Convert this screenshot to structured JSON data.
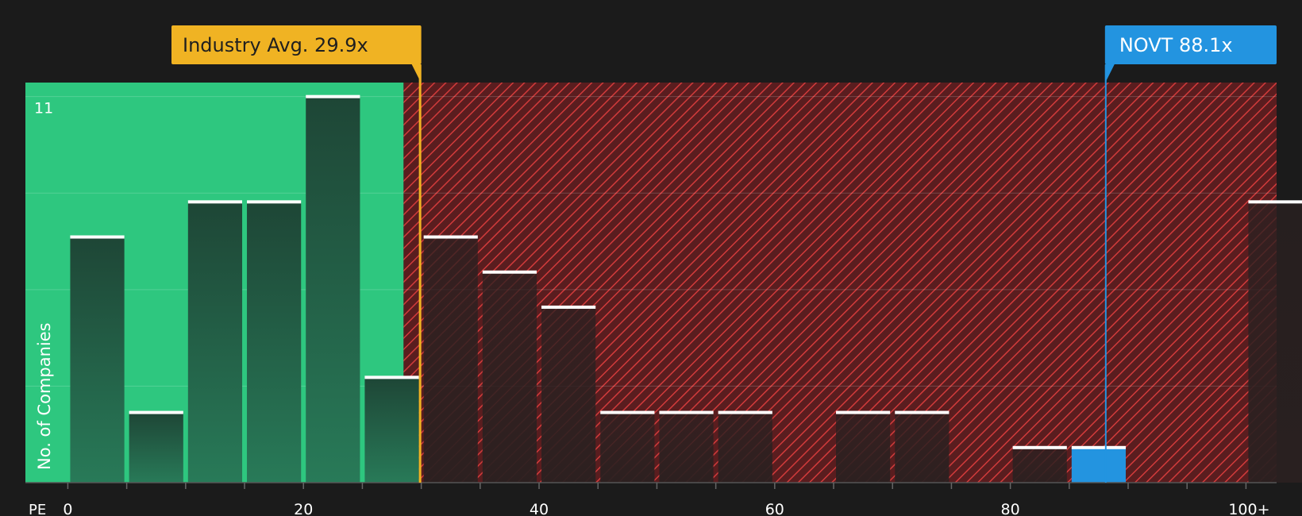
{
  "colors": {
    "background": "#1b1b1b",
    "good_zone": "#2ec77f",
    "bad_zone": "#5a1d1f",
    "hatch": "#d23b3b",
    "bar_good": "#1f4a38",
    "bar_bad": "#2e2222",
    "bar_highlight": "#2394e0",
    "industry": "#f0b323",
    "company": "#2394e0",
    "text": "#ffffff",
    "axis": "#555555"
  },
  "chart_data": {
    "type": "bar",
    "title": "",
    "xlabel": "PE",
    "ylabel": "No. of Companies",
    "xlim": [
      -3.6,
      102.6
    ],
    "ylim": [
      0,
      11.4
    ],
    "y_tick_labels": [
      {
        "value": 11,
        "label": "11"
      }
    ],
    "gridlines_y": [
      2.75,
      5.5,
      8.25,
      11
    ],
    "x_ticks": [
      {
        "value": 0,
        "label": "0"
      },
      {
        "value": 20,
        "label": "20"
      },
      {
        "value": 40,
        "label": "40"
      },
      {
        "value": 60,
        "label": "60"
      },
      {
        "value": 80,
        "label": "80"
      },
      {
        "value": 100,
        "label": "100+"
      }
    ],
    "x_minor_ticks": [
      0,
      5,
      10,
      15,
      20,
      25,
      30,
      35,
      40,
      45,
      50,
      55,
      60,
      65,
      70,
      75,
      80,
      85,
      90,
      95,
      100
    ],
    "bin_width": 5,
    "bins": [
      {
        "start": 0,
        "count": 7
      },
      {
        "start": 5,
        "count": 2
      },
      {
        "start": 10,
        "count": 8
      },
      {
        "start": 15,
        "count": 8
      },
      {
        "start": 20,
        "count": 11
      },
      {
        "start": 25,
        "count": 3
      },
      {
        "start": 30,
        "count": 7
      },
      {
        "start": 35,
        "count": 6
      },
      {
        "start": 40,
        "count": 5
      },
      {
        "start": 45,
        "count": 2
      },
      {
        "start": 50,
        "count": 2
      },
      {
        "start": 55,
        "count": 2
      },
      {
        "start": 65,
        "count": 2
      },
      {
        "start": 70,
        "count": 2
      },
      {
        "start": 80,
        "count": 1
      },
      {
        "start": 85,
        "count": 1,
        "highlight": true
      },
      {
        "start": 100,
        "count": 8
      }
    ],
    "industry_avg": {
      "value": 29.9,
      "label": "Industry Avg. 29.9x"
    },
    "company": {
      "value": 88.1,
      "label": "NOVT 88.1x"
    },
    "good_zone_end": 28.5
  }
}
